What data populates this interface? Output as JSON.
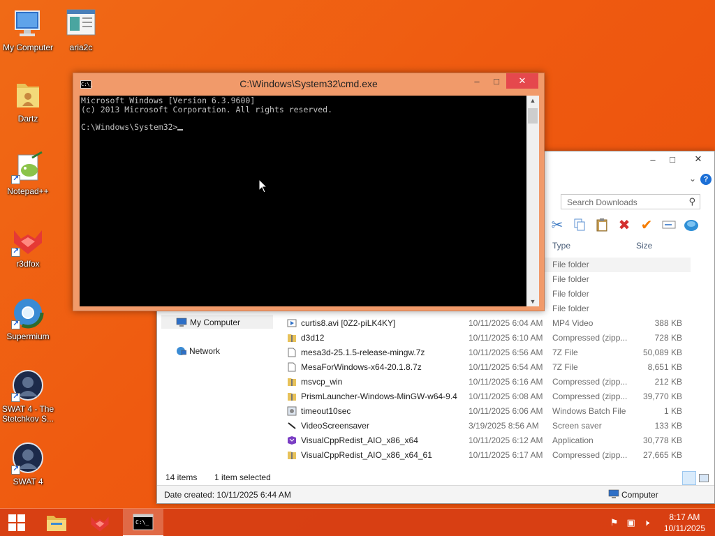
{
  "desktop": {
    "icons": [
      {
        "label": "My Computer"
      },
      {
        "label": "aria2c"
      },
      {
        "label": "Dartz"
      },
      {
        "label": "Notepad++"
      },
      {
        "label": "r3dfox"
      },
      {
        "label": "Supermium"
      },
      {
        "label": "SWAT 4 - The Stetchkov S..."
      },
      {
        "label": "SWAT 4"
      }
    ]
  },
  "cmd": {
    "title": "C:\\Windows\\System32\\cmd.exe",
    "icon_text": "C:\\_",
    "lines": [
      "Microsoft Windows [Version 6.3.9600]",
      "(c) 2013 Microsoft Corporation. All rights reserved.",
      "",
      "C:\\Windows\\System32>"
    ]
  },
  "explorer": {
    "search_placeholder": "Search Downloads",
    "columns": {
      "type": "Type",
      "size": "Size"
    },
    "nav": [
      {
        "label": "My Computer"
      },
      {
        "label": "Network"
      }
    ],
    "rows": [
      {
        "name": "",
        "date": "",
        "type": "File folder",
        "size": ""
      },
      {
        "name": "",
        "date": "",
        "type": "File folder",
        "size": ""
      },
      {
        "name": "",
        "date": "",
        "type": "File folder",
        "size": ""
      },
      {
        "name": "",
        "date": "",
        "type": "File folder",
        "size": ""
      },
      {
        "name": "curtis8.avi [0Z2-piLK4KY]",
        "date": "10/11/2025 6:04 AM",
        "type": "MP4 Video",
        "size": "388 KB"
      },
      {
        "name": "d3d12",
        "date": "10/11/2025 6:10 AM",
        "type": "Compressed (zipp...",
        "size": "728 KB"
      },
      {
        "name": "mesa3d-25.1.5-release-mingw.7z",
        "date": "10/11/2025 6:56 AM",
        "type": "7Z File",
        "size": "50,089 KB"
      },
      {
        "name": "MesaForWindows-x64-20.1.8.7z",
        "date": "10/11/2025 6:54 AM",
        "type": "7Z File",
        "size": "8,651 KB"
      },
      {
        "name": "msvcp_win",
        "date": "10/11/2025 6:16 AM",
        "type": "Compressed (zipp...",
        "size": "212 KB"
      },
      {
        "name": "PrismLauncher-Windows-MinGW-w64-9.4",
        "date": "10/11/2025 6:08 AM",
        "type": "Compressed (zipp...",
        "size": "39,770 KB"
      },
      {
        "name": "timeout10sec",
        "date": "10/11/2025 6:06 AM",
        "type": "Windows Batch File",
        "size": "1 KB"
      },
      {
        "name": "VideoScreensaver",
        "date": "3/19/2025 8:56 AM",
        "type": "Screen saver",
        "size": "133 KB"
      },
      {
        "name": "VisualCppRedist_AIO_x86_x64",
        "date": "10/11/2025 6:12 AM",
        "type": "Application",
        "size": "30,778 KB"
      },
      {
        "name": "VisualCppRedist_AIO_x86_x64_61",
        "date": "10/11/2025 6:17 AM",
        "type": "Compressed (zipp...",
        "size": "27,665 KB"
      }
    ],
    "status": {
      "items": "14 items",
      "selected": "1 item selected"
    },
    "details": {
      "date_created": "Date created: 10/11/2025 6:44 AM",
      "location": "Computer"
    }
  },
  "taskbar": {
    "time": "8:17 AM",
    "date": "10/11/2025"
  },
  "colors": {
    "accent": "#ef5a10",
    "taskbar": "#d63e14",
    "cmd_frame": "#f19a6a"
  }
}
